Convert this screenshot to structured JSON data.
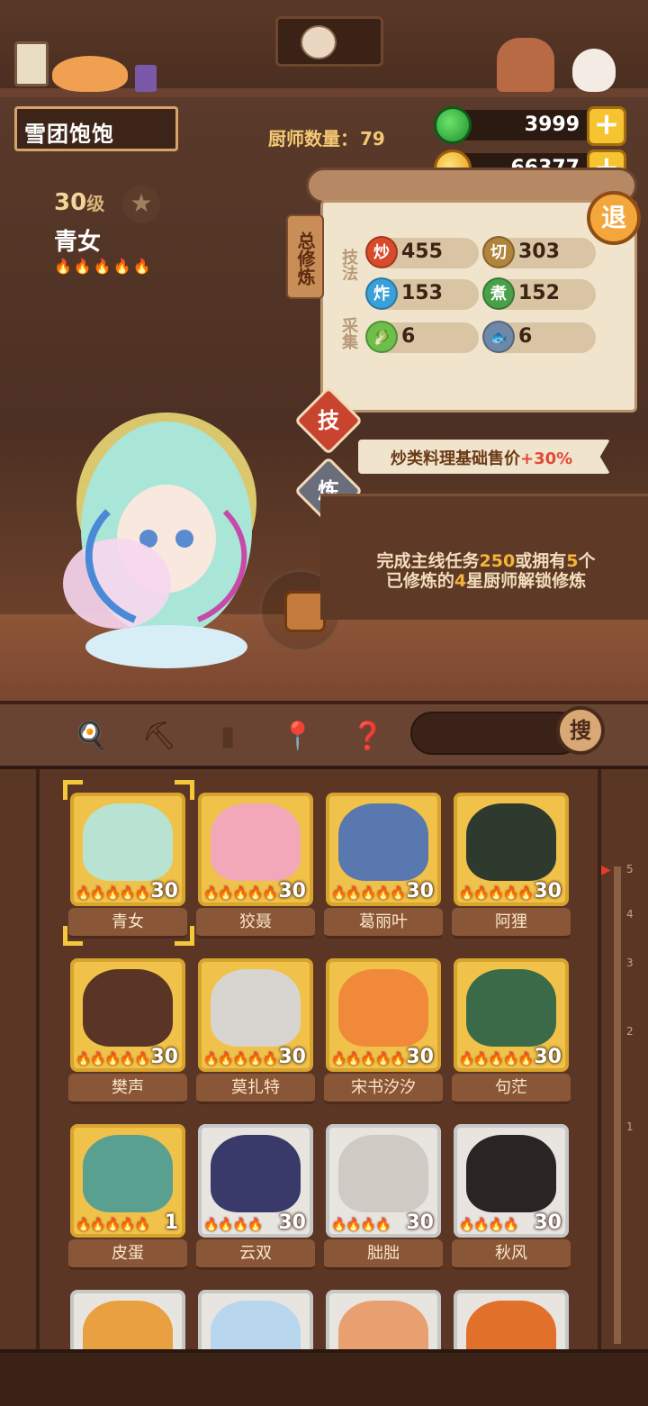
{
  "player": {
    "name": "雪团饱饱"
  },
  "chef_count": {
    "label": "厨师数量：",
    "value": "79"
  },
  "currency": {
    "jade": "3999",
    "coins": "66377"
  },
  "chef": {
    "level": "30",
    "level_unit": "级",
    "name": "青女",
    "flames": "🔥🔥🔥🔥🔥"
  },
  "panel": {
    "side_tab": "总修炼",
    "group_skill": "技法",
    "group_gather": "采集",
    "stats": [
      {
        "icon": "炒",
        "value": "455",
        "color": "#d94a2a"
      },
      {
        "icon": "切",
        "value": "303",
        "color": "#b0843a"
      },
      {
        "icon": "炸",
        "value": "153",
        "color": "#3aa0d9"
      },
      {
        "icon": "煮",
        "value": "152",
        "color": "#4aa04a"
      },
      {
        "icon": "🥬",
        "value": "6",
        "color": "#6bbf4a"
      },
      {
        "icon": "🐟",
        "value": "6",
        "color": "#6f88a8"
      }
    ],
    "quit": "退",
    "tab_skill": "技",
    "tab_refine": "炼",
    "bonus_text": "炒类料理基础售价",
    "bonus_pct": "+30%",
    "unlock": {
      "p1": "完成主线任务",
      "n1": "250",
      "p2": "或拥有",
      "n2": "5",
      "p3": "个",
      "p4": "已修炼的",
      "n3": "4",
      "p5": "星厨师解锁修炼"
    }
  },
  "toolbar": {
    "search_label": "搜"
  },
  "chefs": [
    {
      "name": "青女",
      "level": "30",
      "flames": "🔥🔥🔥🔥🔥",
      "frame": "gold",
      "color": "#b8e3d2"
    },
    {
      "name": "狡聂",
      "level": "30",
      "flames": "🔥🔥🔥🔥🔥",
      "frame": "gold",
      "color": "#f2a8b8"
    },
    {
      "name": "葛丽叶",
      "level": "30",
      "flames": "🔥🔥🔥🔥🔥",
      "frame": "gold",
      "color": "#5a78b0"
    },
    {
      "name": "阿狸",
      "level": "30",
      "flames": "🔥🔥🔥🔥🔥",
      "frame": "gold",
      "color": "#2e3a2e"
    },
    {
      "name": "樊声",
      "level": "30",
      "flames": "🔥🔥🔥🔥🔥",
      "frame": "gold",
      "color": "#5a3424"
    },
    {
      "name": "莫扎特",
      "level": "30",
      "flames": "🔥🔥🔥🔥🔥",
      "frame": "gold",
      "color": "#d8d4d0"
    },
    {
      "name": "宋书汐汐",
      "level": "30",
      "flames": "🔥🔥🔥🔥🔥",
      "frame": "gold",
      "color": "#f08a3a"
    },
    {
      "name": "句茫",
      "level": "30",
      "flames": "🔥🔥🔥🔥🔥",
      "frame": "gold",
      "color": "#3a6a48"
    },
    {
      "name": "皮蛋",
      "level": "1",
      "flames": "🔥🔥🔥🔥🔥",
      "frame": "gold",
      "color": "#5aa090"
    },
    {
      "name": "云双",
      "level": "30",
      "flames": "🔥🔥🔥🔥",
      "frame": "silver",
      "color": "#3a3a6a"
    },
    {
      "name": "朏朏",
      "level": "30",
      "flames": "🔥🔥🔥🔥",
      "frame": "silver",
      "color": "#cfcac4"
    },
    {
      "name": "秋风",
      "level": "30",
      "flames": "🔥🔥🔥🔥",
      "frame": "silver",
      "color": "#2a2424"
    },
    {
      "name": "",
      "level": "",
      "flames": "",
      "frame": "silver",
      "color": "#e8a040"
    },
    {
      "name": "",
      "level": "",
      "flames": "",
      "frame": "silver",
      "color": "#b8d6ee"
    },
    {
      "name": "",
      "level": "",
      "flames": "",
      "frame": "silver",
      "color": "#e8a070"
    },
    {
      "name": "",
      "level": "",
      "flames": "",
      "frame": "silver",
      "color": "#e0702a"
    }
  ],
  "scale": [
    "5",
    "4",
    "3",
    "2",
    "1"
  ]
}
